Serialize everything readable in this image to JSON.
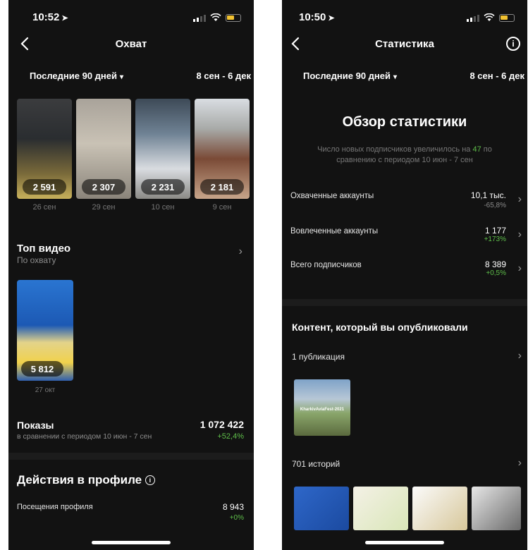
{
  "left": {
    "status": {
      "time": "10:52"
    },
    "nav": {
      "title": "Охват"
    },
    "filter": {
      "period": "Последние 90 дней",
      "range": "8 сен - 6 дек"
    },
    "reach_thumbs": [
      {
        "count": "2 591",
        "date": "26 сен"
      },
      {
        "count": "2 307",
        "date": "29 сен"
      },
      {
        "count": "2 231",
        "date": "10 сен"
      },
      {
        "count": "2 181",
        "date": "9 сен"
      }
    ],
    "top_video": {
      "title": "Топ видео",
      "subtitle": "По охвату",
      "count": "5 812",
      "date": "27 окт"
    },
    "impressions": {
      "title": "Показы",
      "subtitle": "в сравнении с периодом 10 июн - 7 сен",
      "value": "1 072 422",
      "delta": "+52,4%"
    },
    "profile_actions": {
      "title": "Действия в профиле",
      "visits_label": "Посещения профиля",
      "visits_value": "8 943",
      "visits_delta": "+0%"
    }
  },
  "right": {
    "status": {
      "time": "10:50"
    },
    "nav": {
      "title": "Статистика"
    },
    "filter": {
      "period": "Последние 90 дней",
      "range": "8 сен - 6 дек"
    },
    "overview": {
      "title": "Обзор статистики",
      "text_before": "Число новых подписчиков увеличилось на",
      "highlight": "47",
      "text_after": "по сравнению с периодом 10 июн - 7 сен"
    },
    "metrics": [
      {
        "label": "Охваченные аккаунты",
        "value": "10,1 тыс.",
        "delta": "-65,8%"
      },
      {
        "label": "Вовлеченные аккаунты",
        "value": "1 177",
        "delta": "+173%"
      },
      {
        "label": "Всего подписчиков",
        "value": "8 389",
        "delta": "+0,5%"
      }
    ],
    "content": {
      "title": "Контент, который вы опубликовали",
      "posts_label": "1 публикация",
      "post_caption": "KharkivAviaFest-2021",
      "stories_label": "701 историй"
    }
  }
}
